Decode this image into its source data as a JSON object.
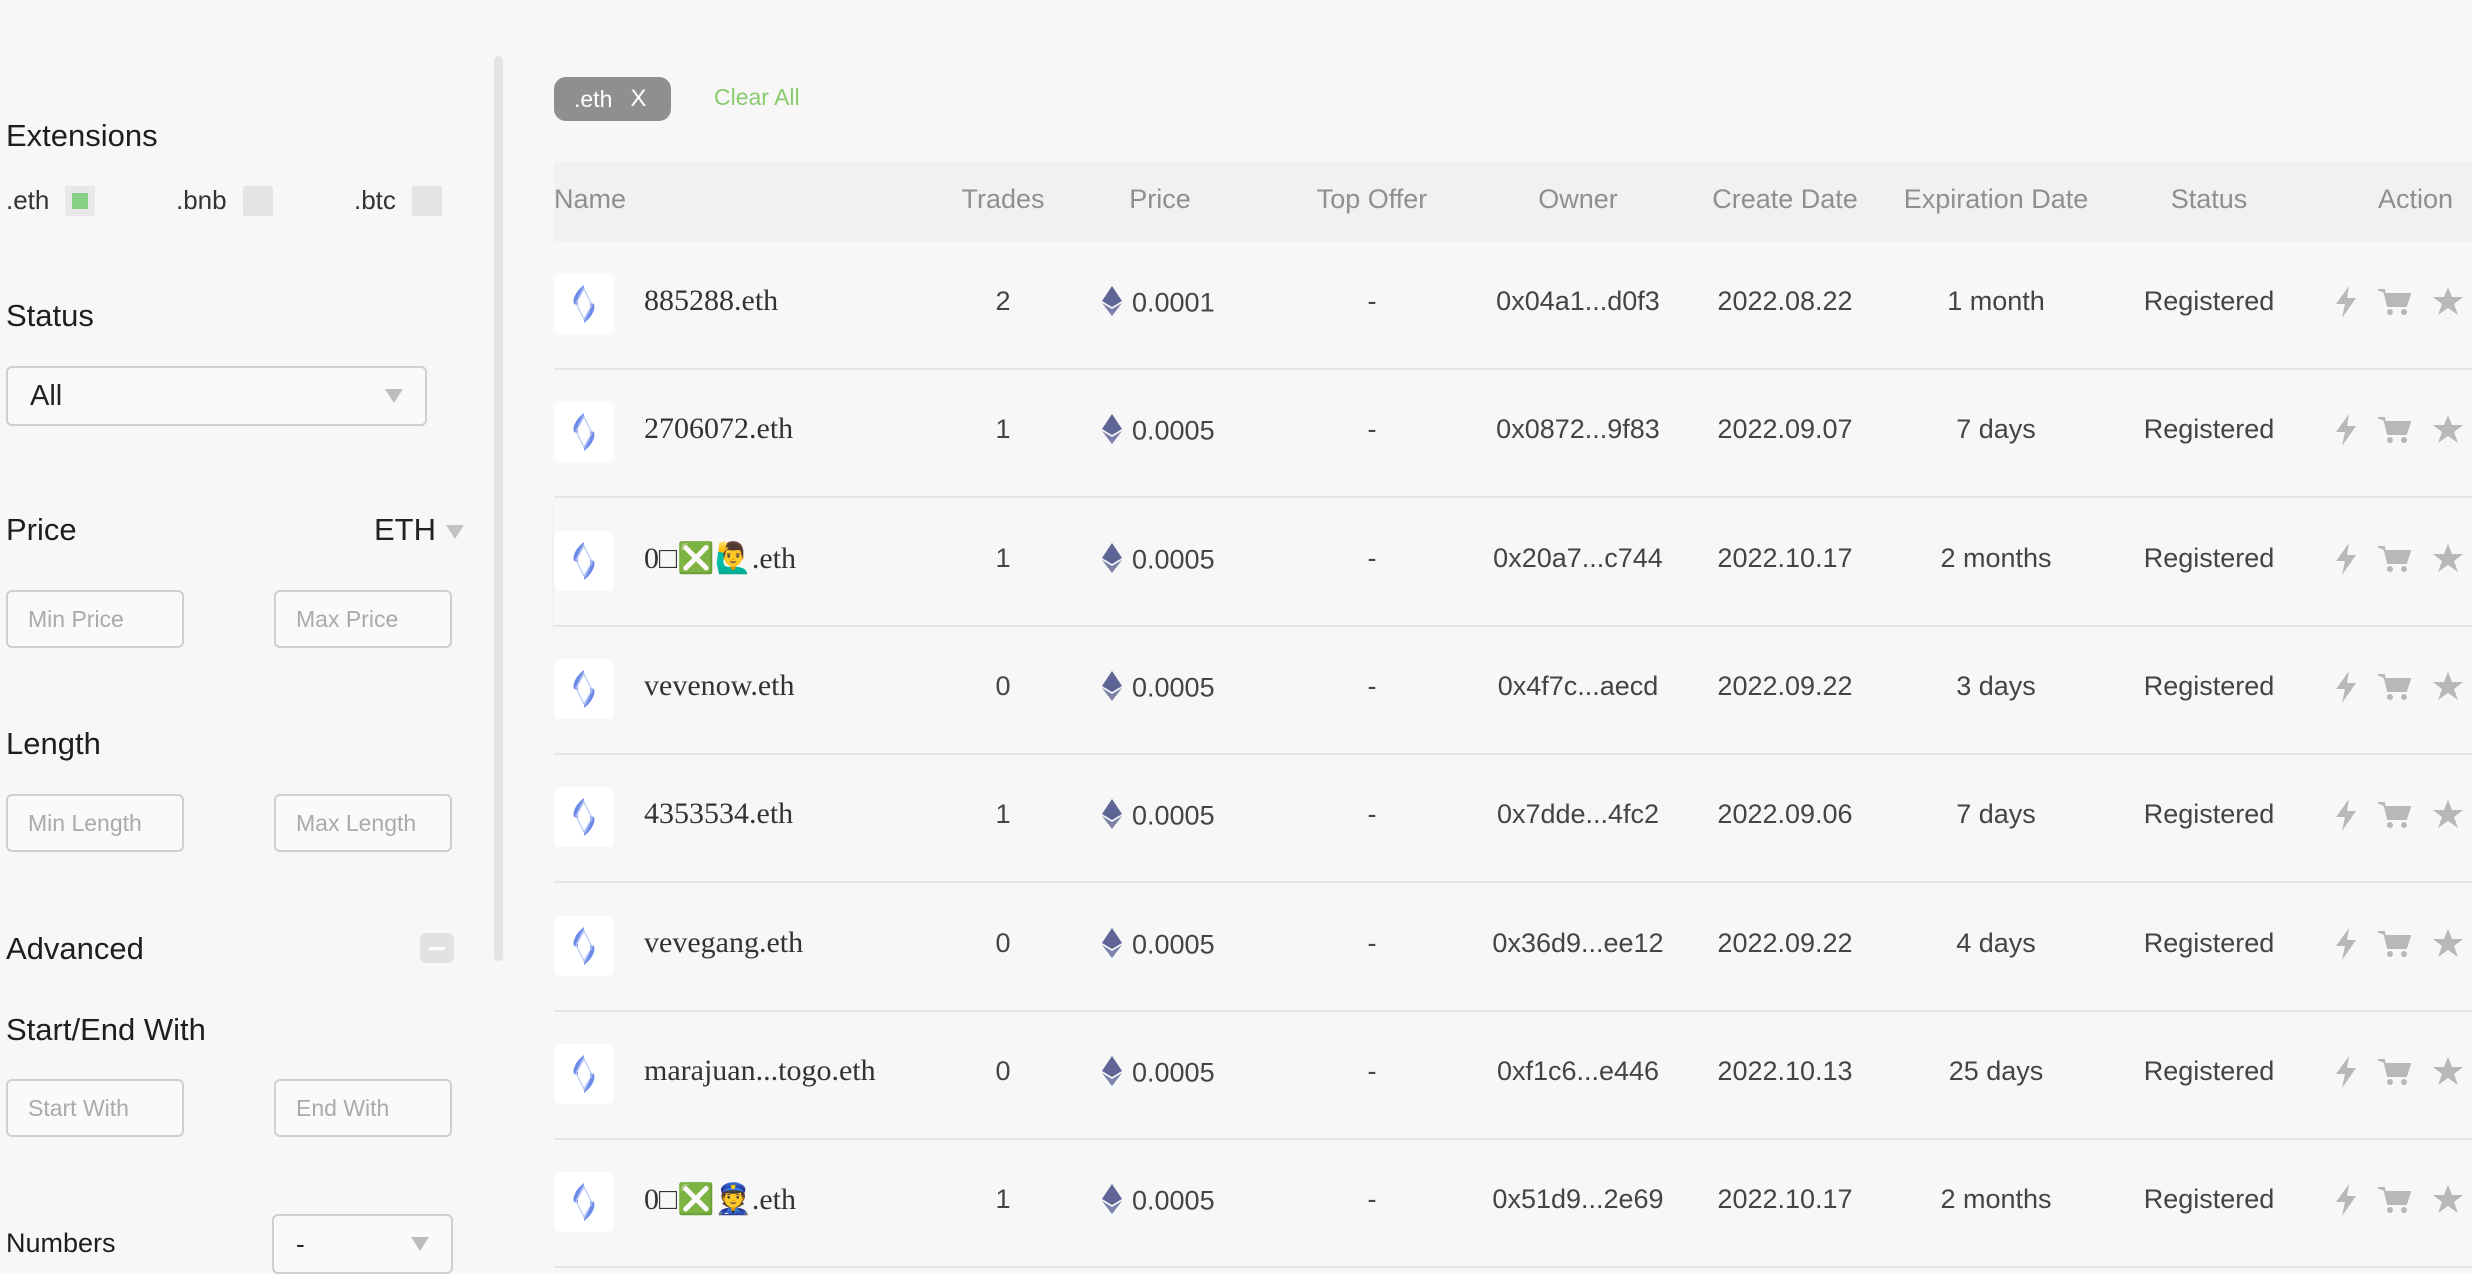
{
  "sidebar": {
    "extensions_title": "Extensions",
    "extensions": [
      {
        "label": ".eth",
        "checked": true
      },
      {
        "label": ".bnb",
        "checked": false
      },
      {
        "label": ".btc",
        "checked": false
      }
    ],
    "status_title": "Status",
    "status_value": "All",
    "price_title": "Price",
    "price_currency": "ETH",
    "min_price_placeholder": "Min Price",
    "max_price_placeholder": "Max Price",
    "length_title": "Length",
    "min_length_placeholder": "Min Length",
    "max_length_placeholder": "Max Length",
    "advanced_title": "Advanced",
    "start_end_title": "Start/End With",
    "start_with_placeholder": "Start With",
    "end_with_placeholder": "End With",
    "numbers_title": "Numbers",
    "numbers_value": "-"
  },
  "filters": {
    "chip_label": ".eth",
    "chip_close": "X",
    "clear_all": "Clear All"
  },
  "table": {
    "headers": {
      "name": "Name",
      "trades": "Trades",
      "price": "Price",
      "top_offer": "Top Offer",
      "owner": "Owner",
      "create_date": "Create Date",
      "expiration_date": "Expiration Date",
      "status": "Status",
      "action": "Action"
    },
    "rows": [
      {
        "name": "885288.eth",
        "trades": "2",
        "price": "0.0001",
        "top_offer": "-",
        "owner": "0x04a1...d0f3",
        "create_date": "2022.08.22",
        "expiration": "1 month",
        "status": "Registered"
      },
      {
        "name": "2706072.eth",
        "trades": "1",
        "price": "0.0005",
        "top_offer": "-",
        "owner": "0x0872...9f83",
        "create_date": "2022.09.07",
        "expiration": "7 days",
        "status": "Registered"
      },
      {
        "name": "0□❎🙋‍♂️.eth",
        "trades": "1",
        "price": "0.0005",
        "top_offer": "-",
        "owner": "0x20a7...c744",
        "create_date": "2022.10.17",
        "expiration": "2 months",
        "status": "Registered"
      },
      {
        "name": "vevenow.eth",
        "trades": "0",
        "price": "0.0005",
        "top_offer": "-",
        "owner": "0x4f7c...aecd",
        "create_date": "2022.09.22",
        "expiration": "3 days",
        "status": "Registered"
      },
      {
        "name": "4353534.eth",
        "trades": "1",
        "price": "0.0005",
        "top_offer": "-",
        "owner": "0x7dde...4fc2",
        "create_date": "2022.09.06",
        "expiration": "7 days",
        "status": "Registered"
      },
      {
        "name": "vevegang.eth",
        "trades": "0",
        "price": "0.0005",
        "top_offer": "-",
        "owner": "0x36d9...ee12",
        "create_date": "2022.09.22",
        "expiration": "4 days",
        "status": "Registered"
      },
      {
        "name": "marajuan...togo.eth",
        "trades": "0",
        "price": "0.0005",
        "top_offer": "-",
        "owner": "0xf1c6...e446",
        "create_date": "2022.10.13",
        "expiration": "25 days",
        "status": "Registered"
      },
      {
        "name": "0□❎👮.eth",
        "trades": "1",
        "price": "0.0005",
        "top_offer": "-",
        "owner": "0x51d9...2e69",
        "create_date": "2022.10.17",
        "expiration": "2 months",
        "status": "Registered"
      }
    ]
  },
  "colors": {
    "accent_green": "#8acb6e",
    "eth_diamond": "#5e6596",
    "chip_bg": "#8f8f8f"
  },
  "icons": [
    "ens-logo-icon",
    "eth-diamond-icon",
    "lightning-icon",
    "cart-icon",
    "star-icon",
    "chevron-down-icon",
    "collapse-icon"
  ]
}
